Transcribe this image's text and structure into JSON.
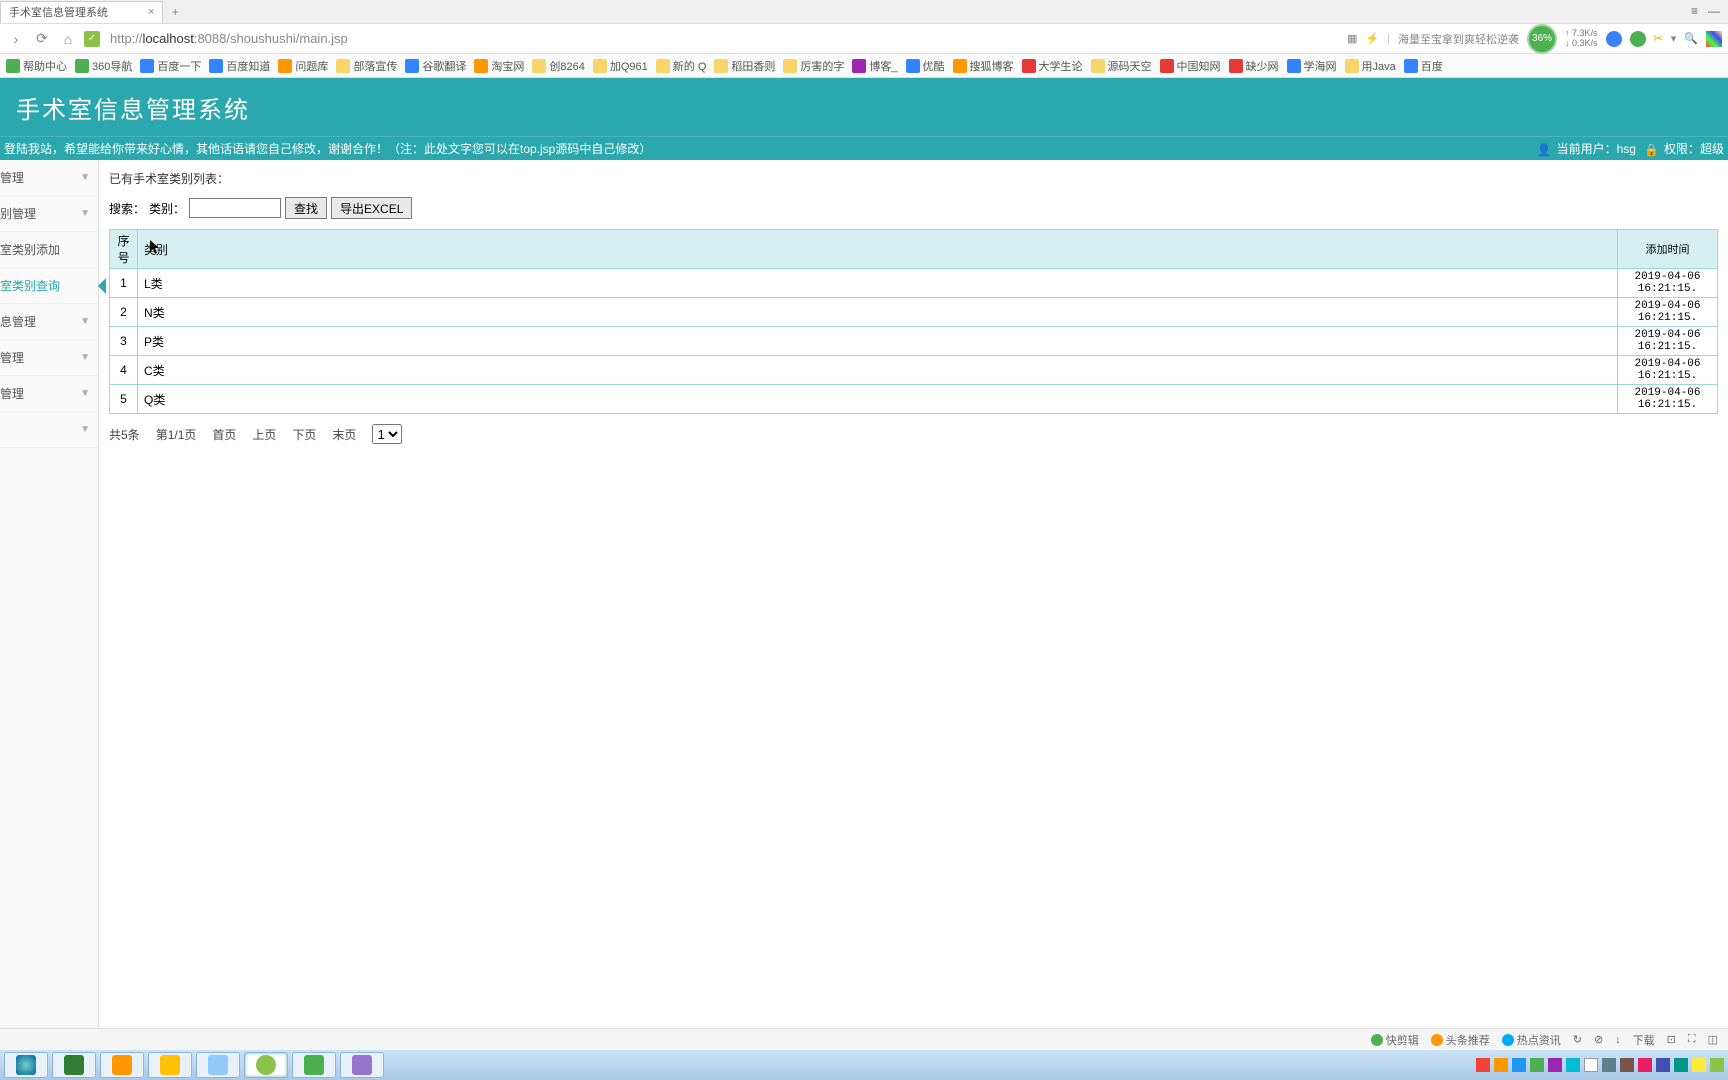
{
  "browser": {
    "tab_title": "手术室信息管理系统",
    "url_prefix": "http://",
    "url_host": "localhost",
    "url_rest": ":8088/shoushushi/main.jsp",
    "promo": "海量至宝拿到爽轻松逆袭",
    "perf": "36%",
    "net_up": "↑ 7.3K/s",
    "net_down": "↓ 0.3K/s"
  },
  "bookmarks": [
    {
      "label": "帮助中心",
      "cls": "g"
    },
    {
      "label": "360导航",
      "cls": "g"
    },
    {
      "label": "百度一下",
      "cls": "b"
    },
    {
      "label": "百度知道",
      "cls": "b"
    },
    {
      "label": "问题库",
      "cls": "o"
    },
    {
      "label": "部落宣传",
      "cls": "folder"
    },
    {
      "label": "谷歌翻译",
      "cls": "b"
    },
    {
      "label": "淘宝网",
      "cls": "o"
    },
    {
      "label": "创8264",
      "cls": "folder"
    },
    {
      "label": "加Q961",
      "cls": "folder"
    },
    {
      "label": "新的 Q",
      "cls": "folder"
    },
    {
      "label": "稻田香则",
      "cls": "folder"
    },
    {
      "label": "厉害的字",
      "cls": "folder"
    },
    {
      "label": "博客_",
      "cls": "p"
    },
    {
      "label": "优酷",
      "cls": "b"
    },
    {
      "label": "搜狐博客",
      "cls": "o"
    },
    {
      "label": "大学生论",
      "cls": "r"
    },
    {
      "label": "源码天空",
      "cls": "folder"
    },
    {
      "label": "中国知网",
      "cls": "r"
    },
    {
      "label": "缺少网",
      "cls": "r"
    },
    {
      "label": "学海网",
      "cls": "b"
    },
    {
      "label": "用Java",
      "cls": "folder"
    },
    {
      "label": "百度",
      "cls": "b"
    }
  ],
  "app": {
    "title": "手术室信息管理系统",
    "welcome": "登陆我站，希望能给你带来好心情，其他话语请您自己修改，谢谢合作！（注：此处文字您可以在top.jsp源码中自己修改）",
    "user_label": "当前用户：",
    "user": "hsg",
    "role_label": "权限：",
    "role": "超级"
  },
  "sidebar": {
    "items": [
      {
        "label": "管理",
        "expandable": true
      },
      {
        "label": "别管理",
        "expandable": true
      },
      {
        "label": "室类别添加",
        "expandable": false
      },
      {
        "label": "室类别查询",
        "expandable": false,
        "active": true
      },
      {
        "label": "息管理",
        "expandable": true
      },
      {
        "label": "管理",
        "expandable": true
      },
      {
        "label": "管理",
        "expandable": true
      },
      {
        "label": "",
        "expandable": true
      }
    ]
  },
  "content": {
    "list_title": "已有手术室类别列表：",
    "search_label": "搜索：",
    "field_label": "类别：",
    "btn_search": "查找",
    "btn_export": "导出EXCEL",
    "cols": {
      "idx": "序号",
      "cat": "类别",
      "time": "添加时间"
    },
    "rows": [
      {
        "idx": "1",
        "cat": "L类",
        "time": "2019-04-06 16:21:15."
      },
      {
        "idx": "2",
        "cat": "N类",
        "time": "2019-04-06 16:21:15."
      },
      {
        "idx": "3",
        "cat": "P类",
        "time": "2019-04-06 16:21:15."
      },
      {
        "idx": "4",
        "cat": "C类",
        "time": "2019-04-06 16:21:15."
      },
      {
        "idx": "5",
        "cat": "Q类",
        "time": "2019-04-06 16:21:15."
      }
    ],
    "pager": {
      "total": "共5条",
      "page": "第1/1页",
      "first": "首页",
      "prev": "上页",
      "next": "下页",
      "last": "末页",
      "sel": "1"
    }
  },
  "status": {
    "items": [
      "快剪辑",
      "头条推荐",
      "热点资讯"
    ],
    "dl": "下载"
  }
}
